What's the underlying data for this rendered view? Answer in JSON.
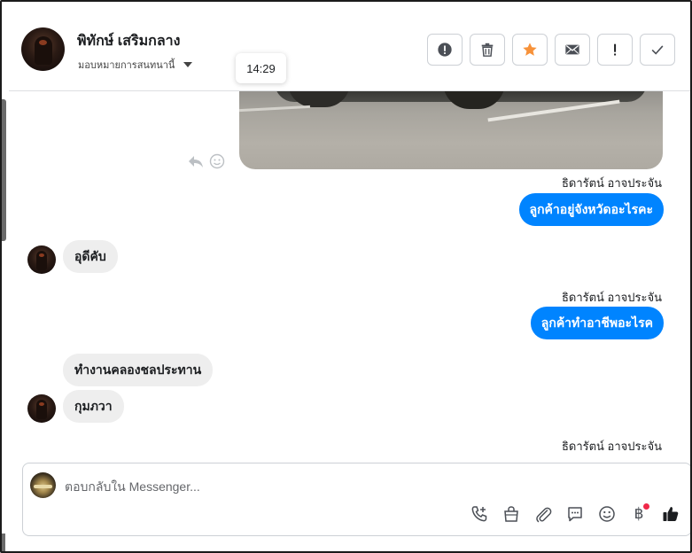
{
  "header": {
    "contact_name": "พิทักษ์ เสริมกลาง",
    "assign_label": "มอบหมายการสนทนานี้",
    "actions": [
      {
        "name": "spam-button",
        "icon": "alert-circle-icon"
      },
      {
        "name": "delete-button",
        "icon": "trash-icon"
      },
      {
        "name": "star-button",
        "icon": "star-icon",
        "color": "#f7923a"
      },
      {
        "name": "mark-unread-button",
        "icon": "envelope-icon"
      },
      {
        "name": "follow-up-button",
        "icon": "exclamation-icon"
      },
      {
        "name": "mark-done-button",
        "icon": "check-icon"
      }
    ]
  },
  "tooltip": {
    "time": "14:29"
  },
  "messages": [
    {
      "type": "outgoing",
      "sender": "ธิดารัตน์ อาจประจัน",
      "text": "ลูกค้าอยู่จังหวัดอะไรคะ"
    },
    {
      "type": "incoming",
      "text": "อุดีคับ"
    },
    {
      "type": "outgoing",
      "sender": "ธิดารัตน์ อาจประจัน",
      "text": "ลูกค้าทำอาชีพอะไรค"
    },
    {
      "type": "incoming",
      "text": "ทำงานคลองชลประทาน"
    },
    {
      "type": "incoming",
      "text": "กุมภวา"
    },
    {
      "type": "outgoing-sender-only",
      "sender": "ธิดารัตน์ อาจประจัน"
    }
  ],
  "composer": {
    "placeholder": "ตอบกลับใน Messenger...",
    "baht_symbol": "฿"
  },
  "colors": {
    "outgoing_bubble": "#0084ff",
    "incoming_bubble": "#eeeeee",
    "star": "#f7923a",
    "badge_dot": "#f02849"
  }
}
